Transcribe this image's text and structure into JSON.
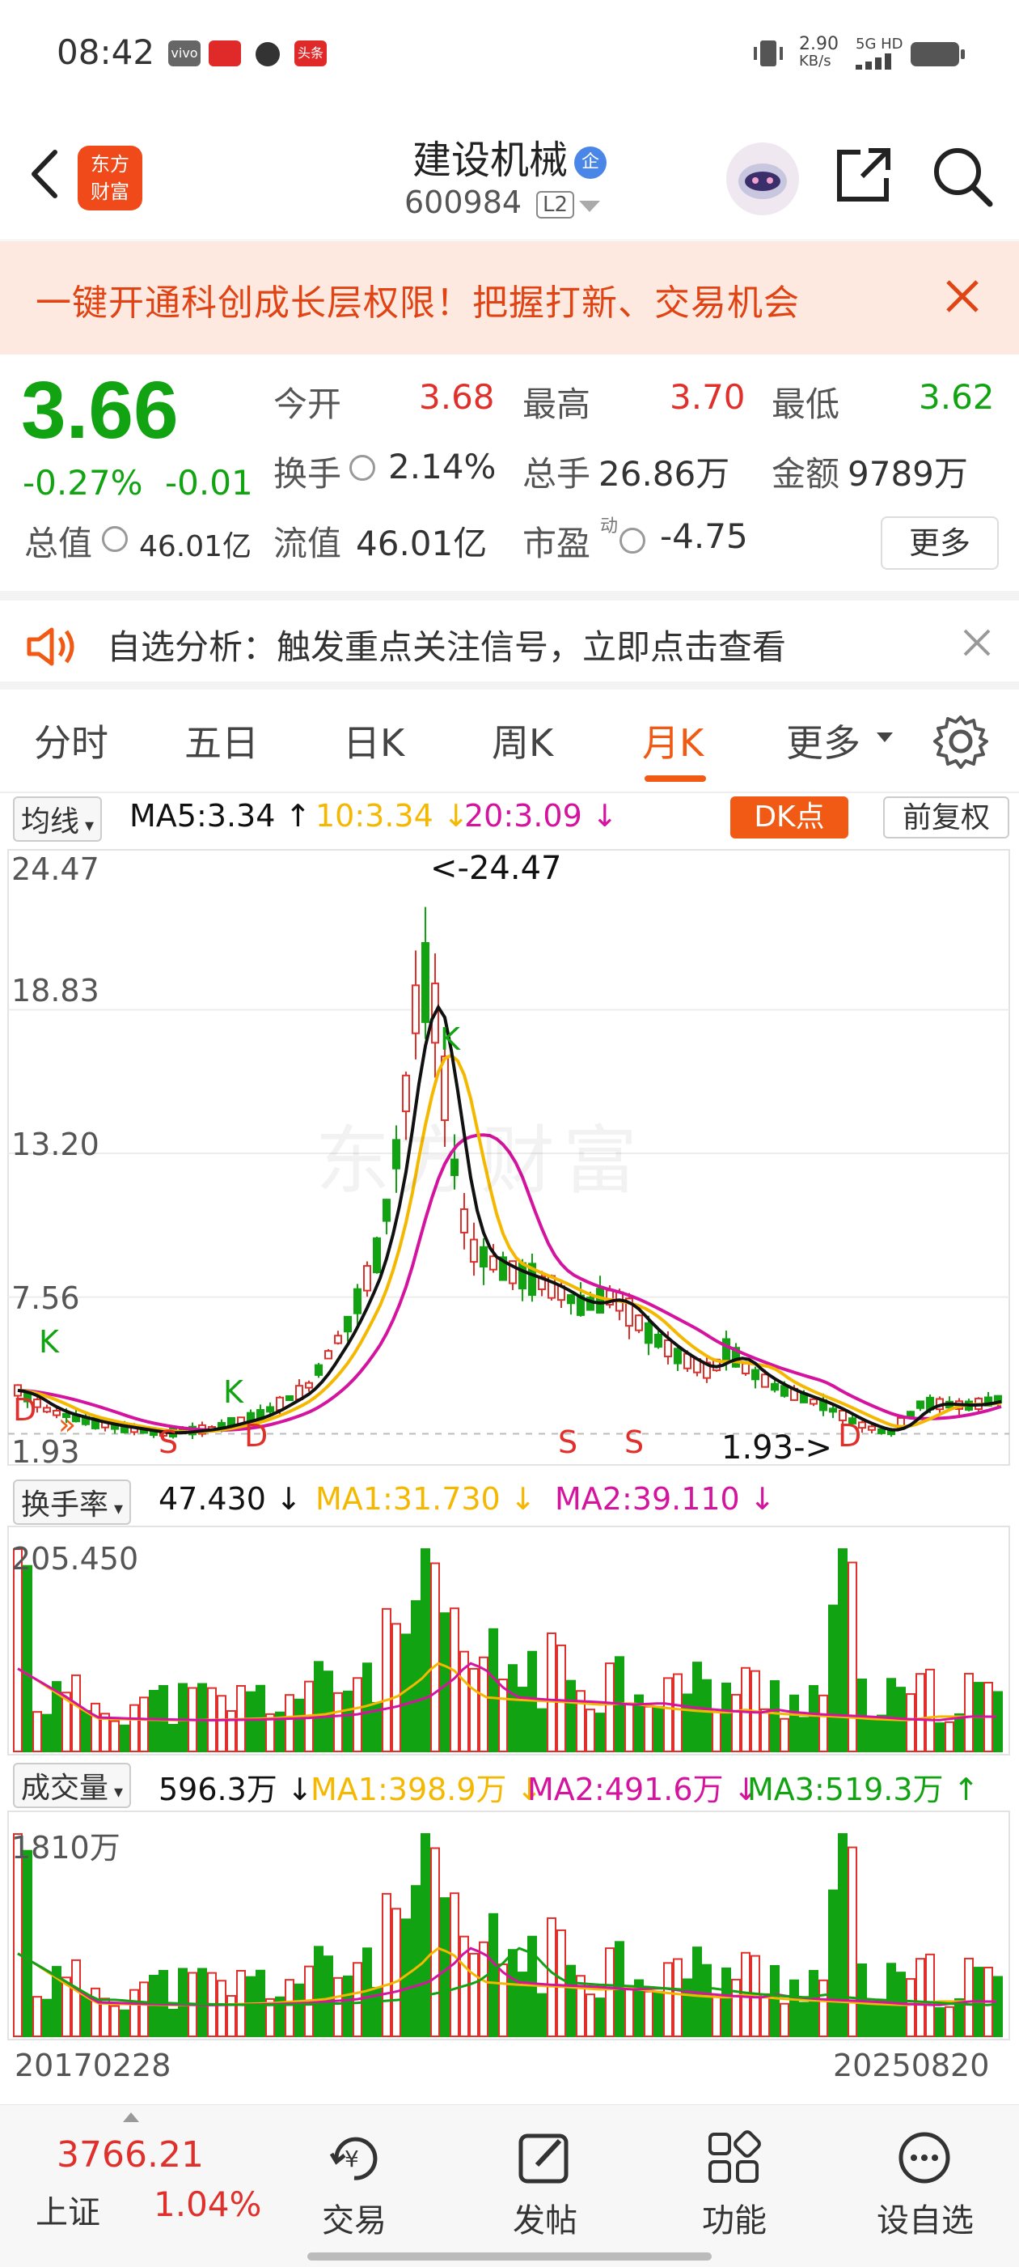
{
  "status_bar": {
    "time": "08:42",
    "net_speed": "2.90",
    "net_unit": "KB/s",
    "net_type": "5G HD",
    "app_badges": [
      "vivo",
      "头条"
    ]
  },
  "header": {
    "stock_name": "建设机械",
    "badge": "企",
    "stock_code": "600984",
    "level": "L2",
    "logo_line1": "东方",
    "logo_line2": "财富"
  },
  "banner": {
    "text": "一键开通科创成长层权限！把握打新、交易机会"
  },
  "quote": {
    "price": "3.66",
    "change_pct": "-0.27%",
    "change_abs": "-0.01",
    "open_label": "今开",
    "open_value": "3.68",
    "high_label": "最高",
    "high_value": "3.70",
    "low_label": "最低",
    "low_value": "3.62",
    "turnover_label": "换手",
    "turnover_value": "2.14%",
    "volume_label": "总手",
    "volume_value": "26.86万",
    "amount_label": "金额",
    "amount_value": "9789万",
    "mktcap_label": "总值",
    "mktcap_value": "46.01亿",
    "float_label": "流值",
    "float_value": "46.01亿",
    "pe_label": "市盈",
    "pe_sup": "动",
    "pe_value": "-4.75",
    "more_button": "更多"
  },
  "alert": {
    "text": "自选分析：触发重点关注信号，立即点击查看"
  },
  "tabs": [
    {
      "label": "分时"
    },
    {
      "label": "五日"
    },
    {
      "label": "日K"
    },
    {
      "label": "周K"
    },
    {
      "label": "月K"
    },
    {
      "label": "更多"
    }
  ],
  "active_tab": "月K",
  "main_chart": {
    "indicator_select": "均线",
    "ma5": "MA5:3.34 ↑",
    "ma10": "10:3.34 ↓",
    "ma20": "20:3.09 ↓",
    "dk_button": "DK点",
    "adjust_button": "前复权",
    "y_labels": [
      "24.47",
      "18.83",
      "13.20",
      "7.56",
      "1.93"
    ],
    "max_marker": "<-24.47",
    "min_marker": "1.93->",
    "watermark": "东方财富",
    "signals": [
      "K",
      "D",
      "K",
      "S",
      "D",
      "K",
      "S",
      "S",
      "D"
    ]
  },
  "turnover_chart": {
    "indicator_select": "换手率",
    "value": "47.430 ↓",
    "ma1": "MA1:31.730 ↓",
    "ma2": "MA2:39.110 ↓",
    "y_max": "205.450"
  },
  "volume_chart": {
    "indicator_select": "成交量",
    "value": "596.3万 ↓",
    "ma1": "MA1:398.9万 ↓",
    "ma2": "MA2:491.6万 ↓",
    "ma3": "MA3:519.3万 ↑",
    "y_max": "1810万",
    "start_date": "20170228",
    "end_date": "20250820"
  },
  "bottom_bar": {
    "index_value": "3766.21",
    "index_name": "上证",
    "index_pct": "1.04%",
    "nav": [
      {
        "label": "交易"
      },
      {
        "label": "发帖"
      },
      {
        "label": "功能"
      },
      {
        "label": "设自选"
      }
    ]
  },
  "colors": {
    "up": "#e0302b",
    "down": "#11a311",
    "accent": "#f05a14",
    "ma_black": "#111111",
    "ma_orange": "#f5b800",
    "ma_magenta": "#d4149e"
  }
}
